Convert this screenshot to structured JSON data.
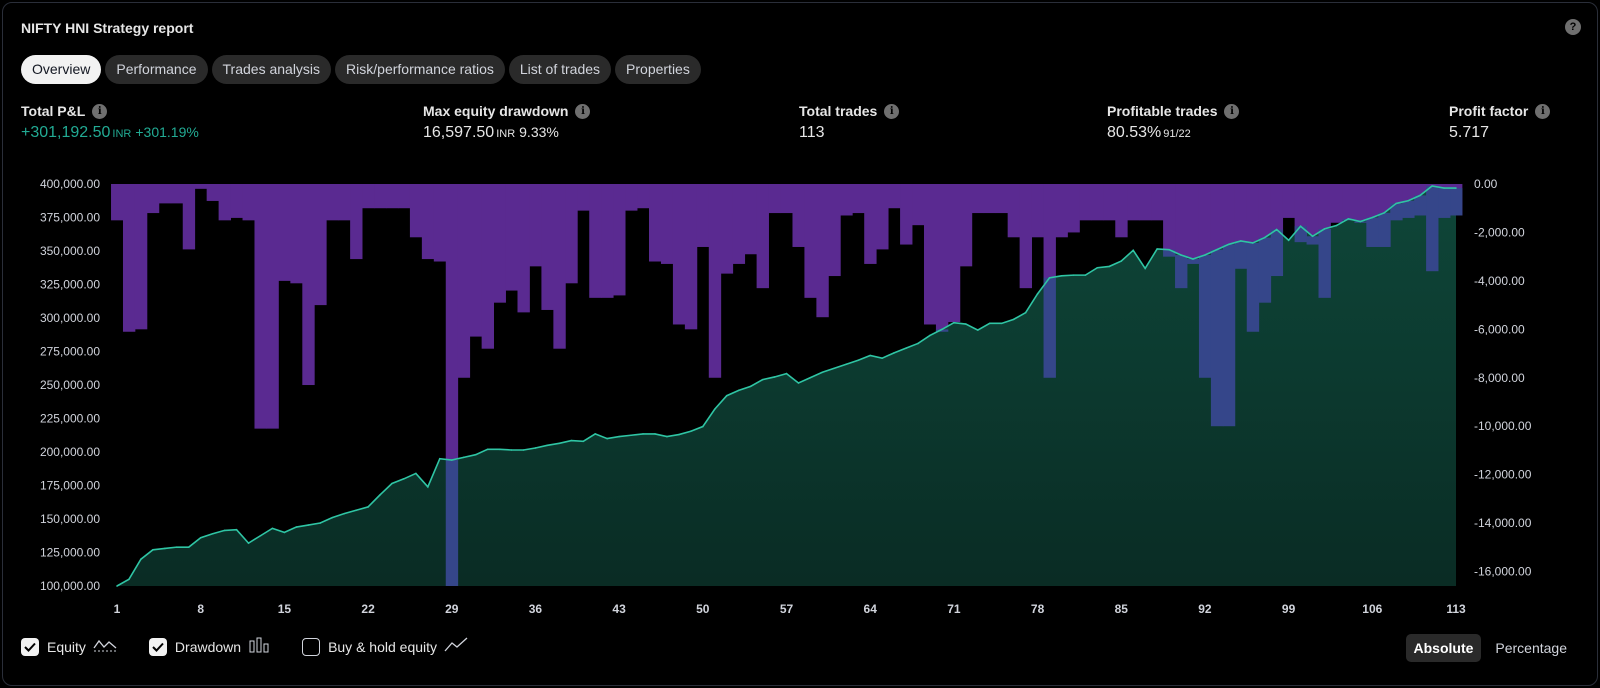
{
  "report": {
    "title": "NIFTY HNI Strategy report",
    "help_icon": "question-icon",
    "tabs": [
      "Overview",
      "Performance",
      "Trades analysis",
      "Risk/performance ratios",
      "List of trades",
      "Properties"
    ],
    "active_tab": "Overview"
  },
  "metrics": {
    "total_pl": {
      "label": "Total P&L",
      "value": "+301,192.50",
      "unit": "INR",
      "pct": "+301.19%"
    },
    "max_drawdown": {
      "label": "Max equity drawdown",
      "value": "16,597.50",
      "unit": "INR",
      "pct": "9.33%"
    },
    "total_trades": {
      "label": "Total trades",
      "value": "113"
    },
    "profitable_trades": {
      "label": "Profitable trades",
      "value": "80.53%",
      "ratio": "91/22"
    },
    "profit_factor": {
      "label": "Profit factor",
      "value": "5.717"
    }
  },
  "colors": {
    "equity_line": "#2fc5a4",
    "equity_fill": "#0b3b30",
    "drawdown_bar": "#5a2a91",
    "drawdown_bar_overlap": "#35468a",
    "positive": "#22ab94"
  },
  "chart_data": {
    "type": "line",
    "x_ticks": [
      1,
      8,
      15,
      22,
      29,
      36,
      43,
      50,
      57,
      64,
      71,
      78,
      85,
      92,
      99,
      106,
      113
    ],
    "y_left_ticks": [
      "400,000.00",
      "375,000.00",
      "350,000.00",
      "325,000.00",
      "300,000.00",
      "275,000.00",
      "250,000.00",
      "225,000.00",
      "200,000.00",
      "175,000.00",
      "150,000.00",
      "125,000.00",
      "100,000.00"
    ],
    "y_right_ticks": [
      "0.00",
      "-2,000.00",
      "-4,000.00",
      "-6,000.00",
      "-8,000.00",
      "-10,000.00",
      "-12,000.00",
      "-14,000.00",
      "-16,000.00"
    ],
    "ylim_left": [
      100000,
      400000
    ],
    "ylim_right": [
      -16597.5,
      0
    ],
    "series": [
      {
        "name": "Equity",
        "values": [
          100000,
          105000,
          120000,
          127000,
          128000,
          129000,
          129000,
          136000,
          139000,
          141500,
          142000,
          132000,
          137500,
          143000,
          140000,
          144000,
          145500,
          147000,
          151000,
          154000,
          156500,
          159000,
          168000,
          176500,
          180000,
          184000,
          174000,
          195000,
          194000,
          196000,
          198000,
          202000,
          202000,
          201500,
          201500,
          203000,
          205000,
          206500,
          208500,
          208000,
          213500,
          210000,
          211500,
          212500,
          213500,
          213500,
          211500,
          213000,
          215500,
          219000,
          232000,
          242000,
          246000,
          249000,
          254000,
          256000,
          258500,
          251500,
          255500,
          259500,
          262500,
          265500,
          268500,
          272000,
          270000,
          274000,
          277500,
          281000,
          287000,
          291500,
          296500,
          295500,
          291000,
          296000,
          296000,
          299000,
          304000,
          318000,
          330000,
          331500,
          332000,
          332000,
          337500,
          338500,
          342500,
          350500,
          337000,
          351500,
          351000,
          347000,
          344000,
          347000,
          351000,
          355000,
          357500,
          356000,
          360000,
          366000,
          358000,
          368500,
          361000,
          366500,
          369000,
          374000,
          372000,
          375000,
          378500,
          385500,
          387500,
          391500,
          398500,
          397000,
          397000
        ]
      },
      {
        "name": "Drawdown",
        "values": [
          -1500,
          -6100,
          -6000,
          -1200,
          -800,
          -800,
          -2700,
          -200,
          -700,
          -1500,
          -1400,
          -1500,
          -10100,
          -10100,
          -4000,
          -4100,
          -8300,
          -5000,
          -1500,
          -1500,
          -3100,
          -1000,
          -1000,
          -1000,
          -1000,
          -2200,
          -3100,
          -3200,
          -16597.5,
          -8000,
          -6300,
          -6800,
          -4900,
          -4400,
          -5300,
          -3400,
          -5200,
          -6800,
          -4100,
          -1100,
          -4700,
          -4700,
          -4600,
          -1100,
          -1000,
          -3200,
          -3300,
          -5800,
          -6000,
          -2600,
          -8000,
          -3700,
          -3300,
          -2900,
          -4300,
          -1200,
          -1200,
          -2600,
          -4700,
          -5500,
          -3800,
          -1300,
          -1200,
          -3300,
          -2700,
          -1000,
          -2500,
          -1700,
          -5800,
          -6100,
          -5700,
          -3400,
          -1200,
          -1200,
          -1200,
          -2200,
          -4300,
          -2200,
          -8000,
          -2200,
          -2000,
          -1500,
          -1500,
          -1500,
          -2200,
          -1500,
          -1500,
          -1500,
          -3000,
          -4300,
          -3300,
          -8000,
          -10000,
          -10000,
          -3500,
          -6100,
          -4900,
          -3800,
          -1400,
          -2400,
          -2500,
          -4700,
          -1600,
          -1500,
          -1600,
          -2600,
          -2600,
          -1500,
          -1400,
          -1300,
          -3600,
          -1400,
          -1300
        ]
      }
    ],
    "legend": [
      "Equity",
      "Drawdown",
      "Buy & hold equity"
    ],
    "grid": false
  },
  "legend_controls": [
    {
      "label": "Equity",
      "checked": true,
      "icon": "equity-line-icon"
    },
    {
      "label": "Drawdown",
      "checked": true,
      "icon": "drawdown-bars-icon"
    },
    {
      "label": "Buy & hold equity",
      "checked": false,
      "icon": "buy-hold-line-icon"
    }
  ],
  "view_modes": {
    "absolute": "Absolute",
    "percentage": "Percentage",
    "active": "Absolute"
  }
}
